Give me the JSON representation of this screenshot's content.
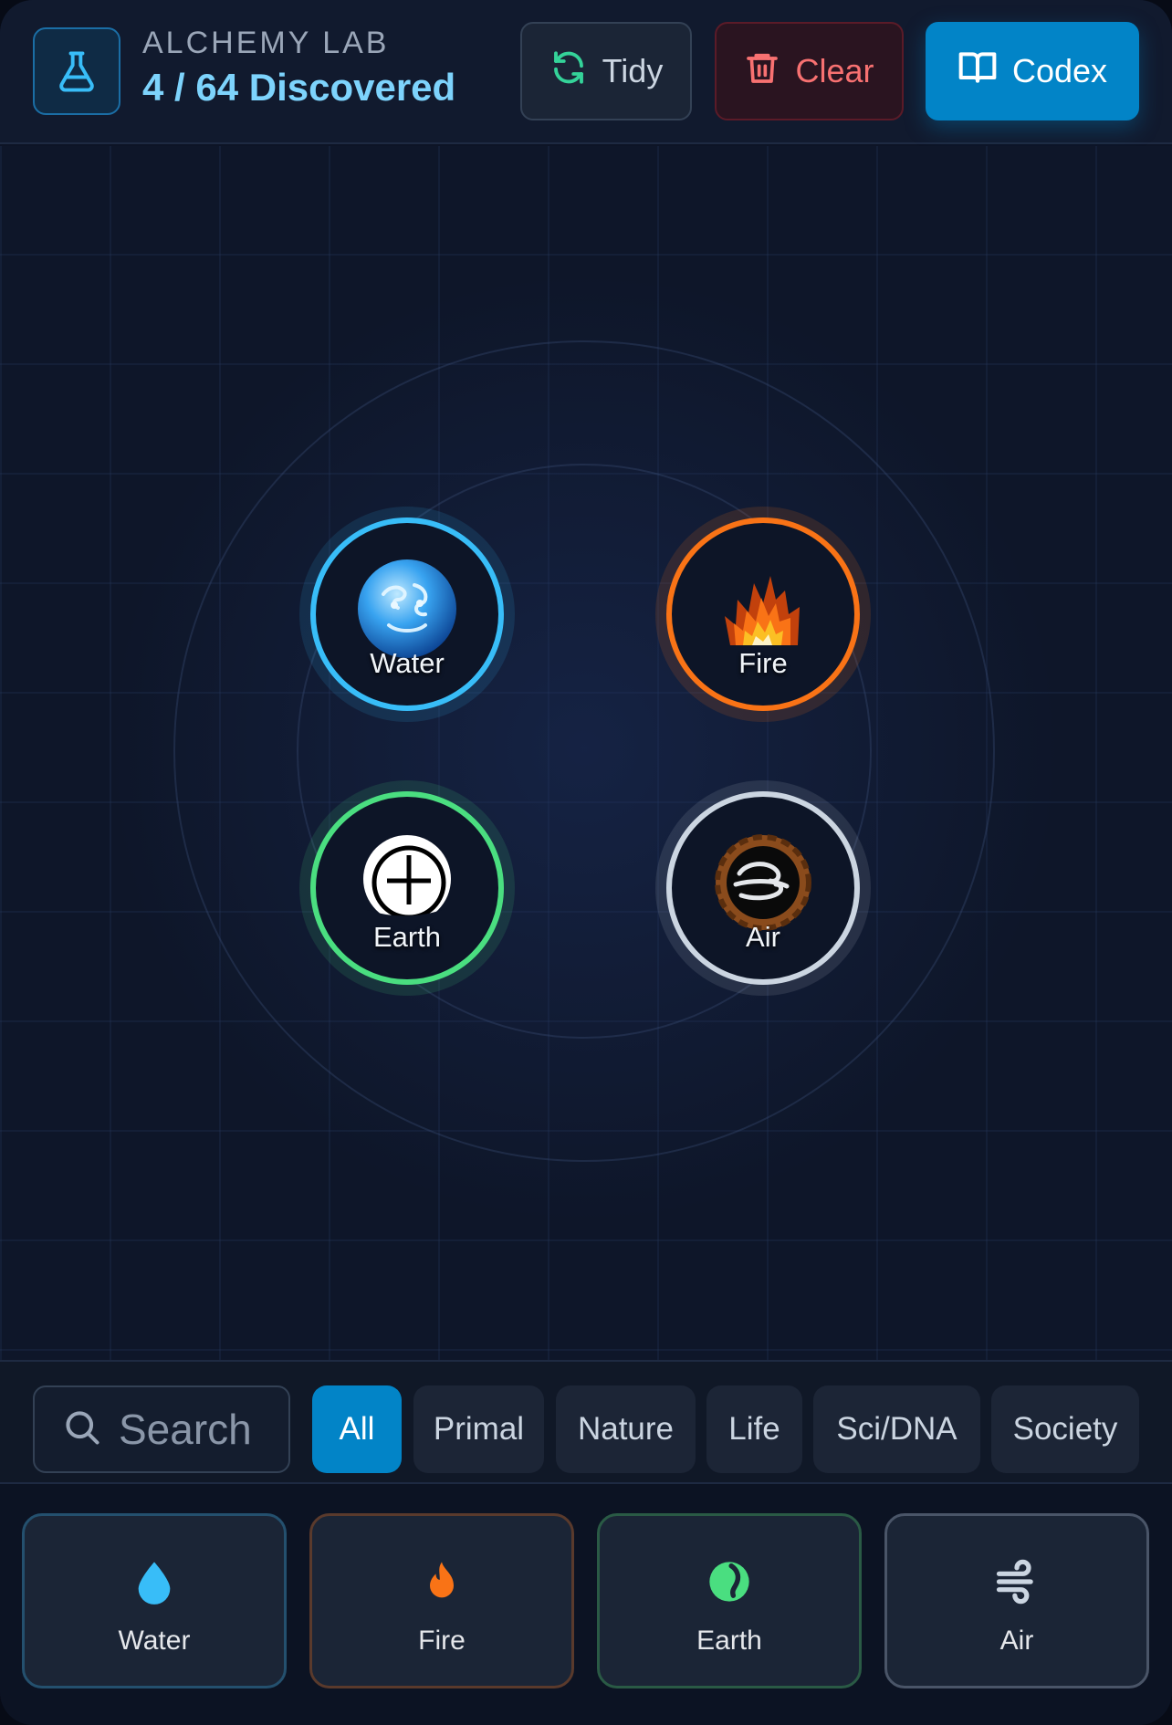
{
  "header": {
    "app_label": "ALCHEMY LAB",
    "discovered": "4 / 64 Discovered",
    "logo_icon": "flask-icon",
    "tidy_label": "Tidy",
    "clear_label": "Clear",
    "codex_label": "Codex"
  },
  "canvas": {
    "nodes": [
      {
        "label": "Water",
        "color": "#38bdf8",
        "icon": "water-globe-icon"
      },
      {
        "label": "Fire",
        "color": "#f97316",
        "icon": "fire-icon"
      },
      {
        "label": "Earth",
        "color": "#4ade80",
        "icon": "earth-symbol-icon"
      },
      {
        "label": "Air",
        "color": "#cbd5e1",
        "icon": "air-swirl-icon"
      }
    ]
  },
  "filters": {
    "search_placeholder": "Search",
    "categories": [
      "All",
      "Primal",
      "Nature",
      "Life",
      "Sci/DNA",
      "Society"
    ],
    "active": "All"
  },
  "inventory": {
    "items": [
      {
        "label": "Water",
        "icon": "droplet-icon",
        "color": "#38bdf8"
      },
      {
        "label": "Fire",
        "icon": "flame-icon",
        "color": "#f97316"
      },
      {
        "label": "Earth",
        "icon": "globe-icon",
        "color": "#4ade80"
      },
      {
        "label": "Air",
        "icon": "wind-icon",
        "color": "#cbd5e1"
      }
    ]
  }
}
